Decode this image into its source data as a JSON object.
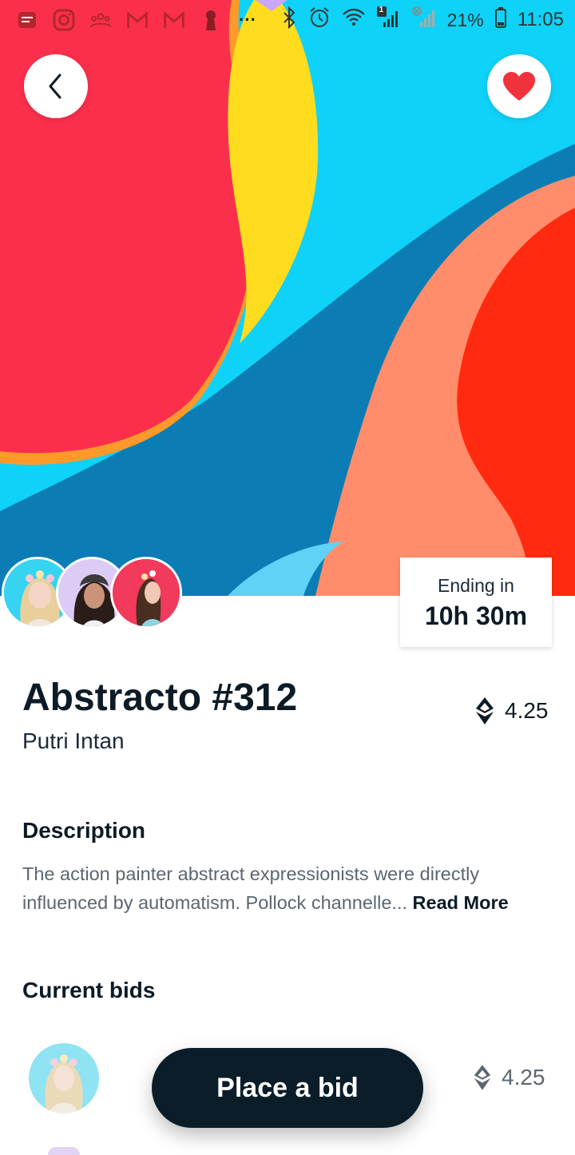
{
  "status_bar": {
    "battery": "21%",
    "time": "11:05",
    "network_badge": "1"
  },
  "artwork": {
    "title": "Abstracto #312",
    "artist": "Putri Intan",
    "price": "4.25",
    "ending_label": "Ending in",
    "ending_time": "10h 30m"
  },
  "description": {
    "heading": "Description",
    "text": "The action painter abstract expressionists were directly influenced by automatism. Pollock channelle... ",
    "read_more": "Read More"
  },
  "bids": {
    "heading": "Current bids",
    "items": [
      {
        "amount": "4.25"
      }
    ]
  },
  "cta": {
    "label": "Place a bid"
  },
  "colors": {
    "primary_dark": "#0b1d28",
    "heart_red": "#f0323c",
    "muted_text": "#5c6670"
  },
  "icons": {
    "back": "chevron-left-icon",
    "favorite": "heart-icon",
    "currency": "ethereum-icon"
  }
}
